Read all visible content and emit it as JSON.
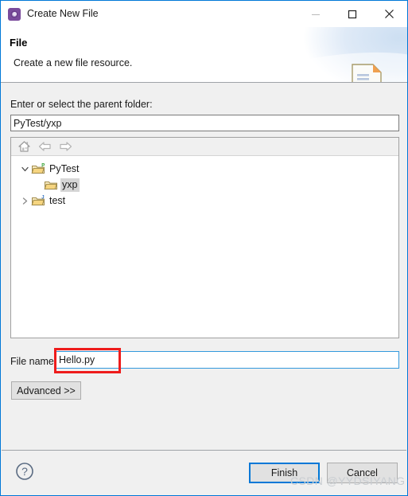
{
  "window": {
    "title": "Create New File",
    "icon": "eclipse-wizard-icon",
    "controls": {
      "minimize": "minimize-icon",
      "maximize": "maximize-icon",
      "close": "close-icon"
    }
  },
  "header": {
    "title": "File",
    "description": "Create a new file resource.",
    "banner_icon": "new-file-document-icon"
  },
  "parent_folder": {
    "label": "Enter or select the parent folder:",
    "value": "PyTest/yxp",
    "placeholder": ""
  },
  "tree": {
    "toolbar": [
      {
        "name": "home-icon",
        "enabled": false
      },
      {
        "name": "back-arrow-icon",
        "enabled": false
      },
      {
        "name": "forward-arrow-icon",
        "enabled": false
      }
    ],
    "nodes": [
      {
        "label": "PyTest",
        "icon": "project-folder-icon",
        "badge": "P",
        "badge_color": "#2e9e2e",
        "twisty": "expanded",
        "indent": 1,
        "selected": false
      },
      {
        "label": "yxp",
        "icon": "folder-icon",
        "badge": "",
        "badge_color": "",
        "twisty": "none",
        "indent": 2,
        "selected": true
      },
      {
        "label": "test",
        "icon": "project-folder-icon",
        "badge": "J",
        "badge_color": "#2f6fbf",
        "twisty": "collapsed",
        "indent": 1,
        "selected": false
      }
    ]
  },
  "file_name": {
    "label": "File name",
    "value": "Hello.py",
    "placeholder": "",
    "annotation_color": "#ee1c1c"
  },
  "advanced_button": {
    "label": "Advanced  >>"
  },
  "footer": {
    "help_icon": "help-question-icon",
    "finish_label": "Finish",
    "cancel_label": "Cancel",
    "focus_color": "#0078d7"
  },
  "watermark": {
    "text": "CSDN @YYDSIYANG"
  }
}
